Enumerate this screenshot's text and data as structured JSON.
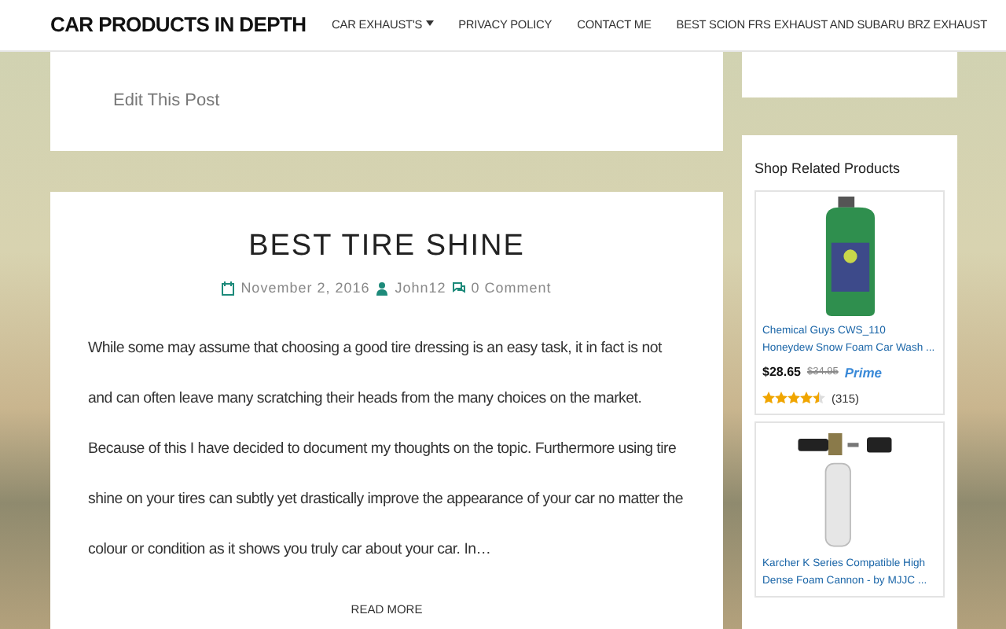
{
  "navbar": {
    "brand": "CAR PRODUCTS IN DEPTH",
    "items": [
      {
        "label": "CAR EXHAUST'S",
        "dropdown": true
      },
      {
        "label": "PRIVACY POLICY",
        "dropdown": false
      },
      {
        "label": "CONTACT ME",
        "dropdown": false
      },
      {
        "label": "BEST SCION FRS EXHAUST AND SUBARU BRZ EXHAUST",
        "dropdown": false
      }
    ]
  },
  "previous_post": {
    "edit_link": "Edit This Post"
  },
  "post": {
    "title": "BEST TIRE SHINE",
    "date": "November 2, 2016",
    "author": "John12",
    "comments": "0 Comment",
    "excerpt": "While some may assume that choosing a good tire dressing is an easy task, it in fact is not and can often leave many scratching their heads from the many choices on the market. Because of this I have decided to document my thoughts on the topic. Furthermore using tire shine on your tires can subtly yet drastically improve the appearance of your car no matter the colour or condition as it shows you truly car about your car. In…",
    "read_more": "READ MORE"
  },
  "sidebar": {
    "widget_title": "Shop Related Products",
    "products": [
      {
        "kind": "bottle",
        "name": "Chemical Guys CWS_110 Honeydew Snow Foam Car Wash ...",
        "price": "$28.65",
        "old_price": "$34.95",
        "badge": "Prime",
        "stars": 4.5,
        "reviews": "(315)"
      },
      {
        "kind": "cannon",
        "name": "Karcher K Series Compatible High Dense Foam Cannon - by MJJC ..."
      }
    ]
  }
}
